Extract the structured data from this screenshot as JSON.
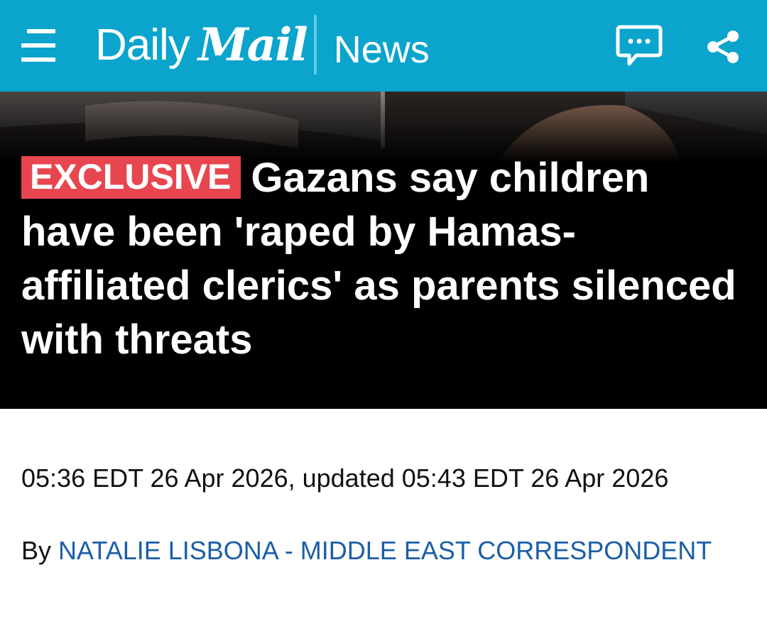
{
  "header": {
    "brand_daily": "Daily",
    "brand_mail": "Mail",
    "section": "News",
    "bg_color": "#0aa4cd",
    "icons": [
      "menu-icon",
      "comments-icon",
      "share-icon"
    ]
  },
  "article": {
    "badge": "EXCLUSIVE",
    "badge_color": "#e8464f",
    "headline": "Gazans say children have been 'raped by Hamas-affiliated clerics' as parents silenced with threats",
    "timestamp": "05:36 EDT 26 Apr 2026, updated 05:43 EDT 26 Apr 2026",
    "by_prefix": "By",
    "author": "NATALIE LISBONA - MIDDLE EAST CORRESPONDENT",
    "author_color": "#1b5ea8"
  }
}
